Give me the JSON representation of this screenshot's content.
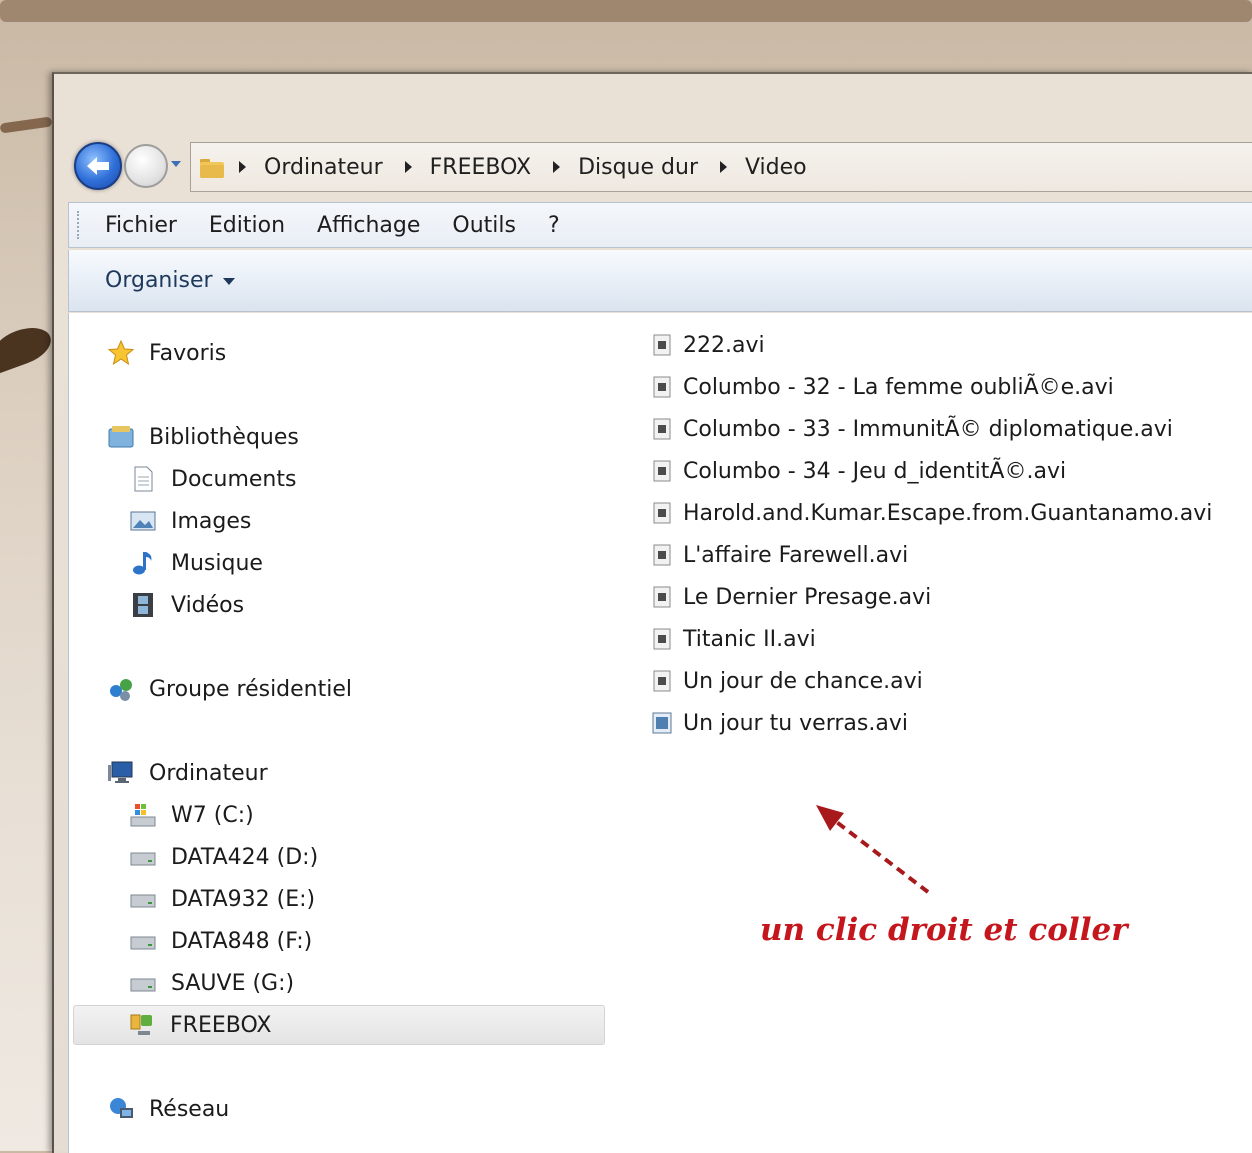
{
  "breadcrumb": [
    "Ordinateur",
    "FREEBOX",
    "Disque dur",
    "Video"
  ],
  "menu": [
    "Fichier",
    "Edition",
    "Affichage",
    "Outils",
    "?"
  ],
  "command_bar": {
    "organize": "Organiser"
  },
  "nav": {
    "favorites": "Favoris",
    "libraries": "Bibliothèques",
    "library_items": [
      "Documents",
      "Images",
      "Musique",
      "Vidéos"
    ],
    "homegroup": "Groupe résidentiel",
    "computer": "Ordinateur",
    "drives": [
      "W7 (C:)",
      "DATA424 (D:)",
      "DATA932 (E:)",
      "DATA848 (F:)",
      "SAUVE (G:)",
      "FREEBOX"
    ],
    "selected": "FREEBOX",
    "network": "Réseau"
  },
  "files": [
    "222.avi",
    "Columbo - 32 - La femme oubliÃ©e.avi",
    "Columbo - 33 - ImmunitÃ© diplomatique.avi",
    "Columbo - 34 - Jeu d_identitÃ©.avi",
    "Harold.and.Kumar.Escape.from.Guantanamo.avi",
    "L'affaire Farewell.avi",
    "Le Dernier Presage.avi",
    "Titanic II.avi",
    "Un jour de chance.avi",
    "Un jour tu verras.avi"
  ],
  "annotation": "un clic droit et coller",
  "colors": {
    "annotation": "#c4161c",
    "command_text": "#1e395b"
  }
}
